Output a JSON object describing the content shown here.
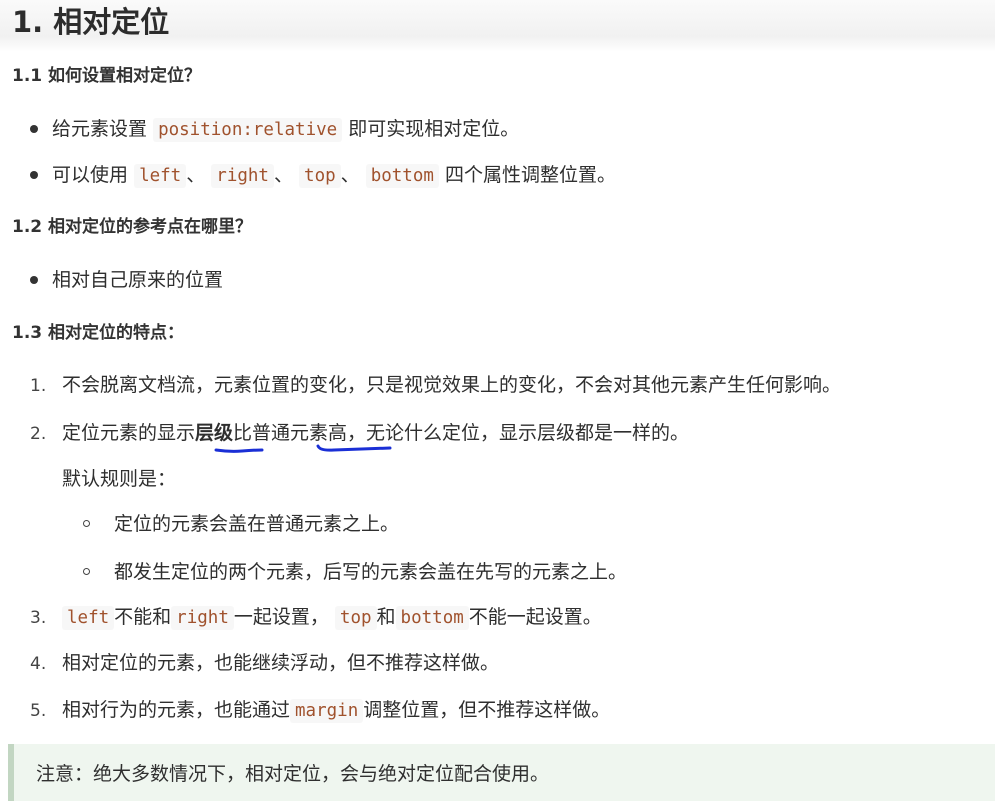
{
  "title": "1. 相对定位",
  "section1": {
    "heading": "1.1 如何设置相对定位？",
    "bullet1": {
      "pre": "给元素设置",
      "code": "position:relative",
      "post": "即可实现相对定位。"
    },
    "bullet2": {
      "pre": "可以使用",
      "code1": "left",
      "sep1": "、",
      "code2": "right",
      "sep2": "、",
      "code3": "top",
      "sep3": "、",
      "code4": "bottom",
      "post": "四个属性调整位置。"
    }
  },
  "section2": {
    "heading": "1.2 相对定位的参考点在哪里？",
    "bullet1": "相对自己原来的位置"
  },
  "section3": {
    "heading": "1.3 相对定位的特点：",
    "item1": {
      "num": "1.",
      "text": "不会脱离文档流，元素位置的变化，只是视觉效果上的变化，不会对其他元素产生任何影响。"
    },
    "item2": {
      "num": "2.",
      "pre": "定位元素的显示",
      "bold": "层级",
      "mid": "比普通元素高",
      "post": "，无论什么定位，显示层级都是一样的。"
    },
    "default_rule": "默认规则是：",
    "sub1": "定位的元素会盖在普通元素之上。",
    "sub2": "都发生定位的两个元素，后写的元素会盖在先写的元素之上。",
    "item3": {
      "num": "3.",
      "code1": "left",
      "t1": "不能和",
      "code2": "right",
      "t2": "一起设置，",
      "code3": "top",
      "t3": "和",
      "code4": "bottom",
      "t4": "不能一起设置。"
    },
    "item4": {
      "num": "4.",
      "text": "相对定位的元素，也能继续浮动，但不推荐这样做。"
    },
    "item5": {
      "num": "5.",
      "pre": "相对行为的元素，也能通过",
      "code": "margin",
      "post": "调整位置，但不推荐这样做。"
    }
  },
  "note": "注意：绝大多数情况下，相对定位，会与绝对定位配合使用。",
  "colors": {
    "code_text": "#a0522d",
    "code_bg": "#f7f7f7",
    "note_bg": "#eff6ef",
    "note_border": "#c2d6c2",
    "annotation_ink": "#1a2fd6"
  }
}
